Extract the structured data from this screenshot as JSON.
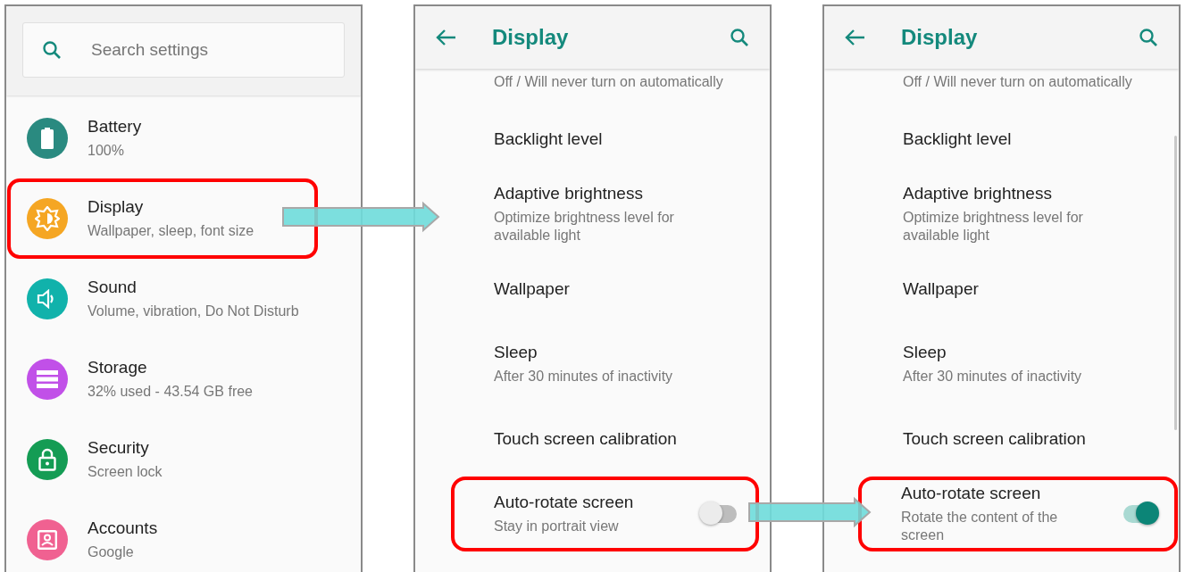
{
  "panels": [
    {
      "kind": "main",
      "search": {
        "placeholder": "Search settings"
      },
      "items": [
        {
          "kind": "battery",
          "title": "Battery",
          "subtitle": "100%",
          "color": "#2a8a80",
          "highlighted": false
        },
        {
          "kind": "display",
          "title": "Display",
          "subtitle": "Wallpaper, sleep, font size",
          "color": "#f5a623",
          "highlighted": true
        },
        {
          "kind": "sound",
          "title": "Sound",
          "subtitle": "Volume, vibration, Do Not Disturb",
          "color": "#11b2ab",
          "highlighted": false
        },
        {
          "kind": "storage",
          "title": "Storage",
          "subtitle": "32% used - 43.54 GB free",
          "color": "#c150e8",
          "highlighted": false
        },
        {
          "kind": "security",
          "title": "Security",
          "subtitle": "Screen lock",
          "color": "#149c54",
          "highlighted": false
        },
        {
          "kind": "accounts",
          "title": "Accounts",
          "subtitle": "Google",
          "color": "#f06191",
          "highlighted": false
        }
      ]
    },
    {
      "kind": "detail",
      "title": "Display",
      "scrollbar_visible": false,
      "partial_subtitle": "Off / Will never turn on automatically",
      "items": [
        {
          "kind": "plain",
          "title": "Backlight level",
          "highlighted": false
        },
        {
          "kind": "plain",
          "title": "Adaptive brightness",
          "subtitle": "Optimize brightness level for available light",
          "highlighted": false
        },
        {
          "kind": "plain",
          "title": "Wallpaper",
          "highlighted": false
        },
        {
          "kind": "plain",
          "title": "Sleep",
          "subtitle": "After 30 minutes of inactivity",
          "highlighted": false
        },
        {
          "kind": "plain",
          "title": "Touch screen calibration",
          "highlighted": false
        },
        {
          "kind": "toggle",
          "title": "Auto-rotate screen",
          "subtitle": "Stay in portrait view",
          "on": false,
          "highlighted": true
        }
      ]
    },
    {
      "kind": "detail",
      "title": "Display",
      "scrollbar_visible": true,
      "partial_subtitle": "Off / Will never turn on automatically",
      "items": [
        {
          "kind": "plain",
          "title": "Backlight level",
          "highlighted": false
        },
        {
          "kind": "plain",
          "title": "Adaptive brightness",
          "subtitle": "Optimize brightness level for available light",
          "highlighted": false
        },
        {
          "kind": "plain",
          "title": "Wallpaper",
          "highlighted": false
        },
        {
          "kind": "plain",
          "title": "Sleep",
          "subtitle": "After 30 minutes of inactivity",
          "highlighted": false
        },
        {
          "kind": "plain",
          "title": "Touch screen calibration",
          "highlighted": false
        },
        {
          "kind": "toggle",
          "title": "Auto-rotate screen",
          "subtitle": "Rotate the content of the screen",
          "on": true,
          "highlighted": true
        }
      ]
    }
  ]
}
